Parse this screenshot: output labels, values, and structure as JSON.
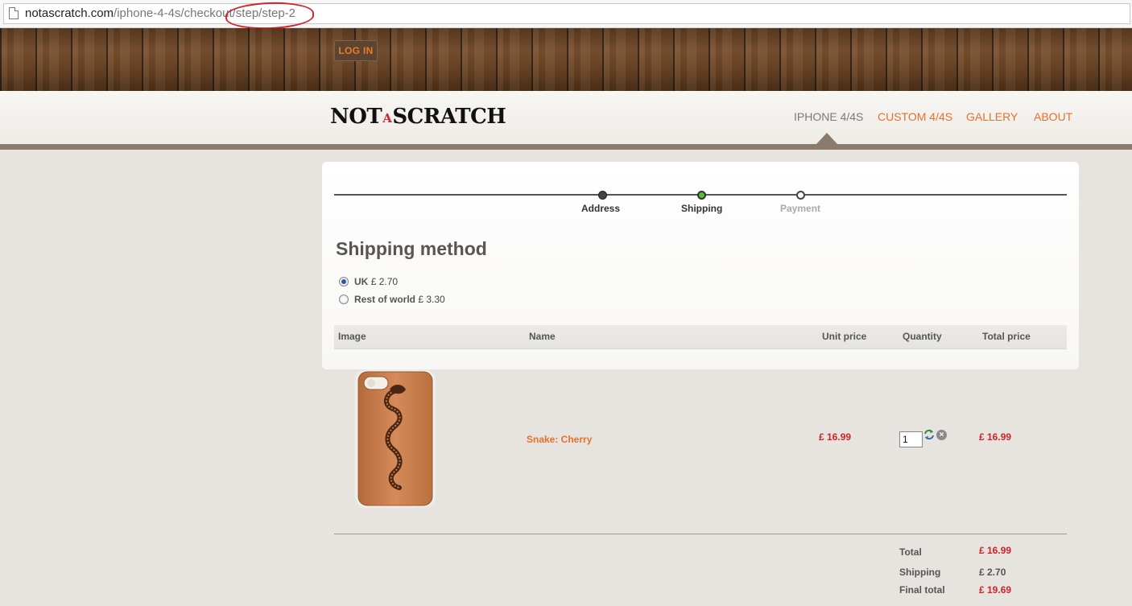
{
  "browser": {
    "url_host": "notascratch.com",
    "url_path_1": "/iphone-4-4s/checkout",
    "url_path_2": "/step/step-2"
  },
  "header": {
    "login_label": "LOG IN"
  },
  "logo": {
    "part1": "NOT",
    "part2": "A",
    "part3": "SCRATCH"
  },
  "nav": {
    "items": [
      {
        "label": "IPHONE 4/4S",
        "active": true
      },
      {
        "label": "CUSTOM 4/4S",
        "active": false
      },
      {
        "label": "GALLERY",
        "active": false
      },
      {
        "label": "ABOUT",
        "active": false
      }
    ]
  },
  "steps": [
    {
      "label": "Address",
      "state": "done"
    },
    {
      "label": "Shipping",
      "state": "current"
    },
    {
      "label": "Payment",
      "state": "todo"
    }
  ],
  "shipping": {
    "title": "Shipping method",
    "options": [
      {
        "name": "UK",
        "price": "£ 2.70",
        "selected": true
      },
      {
        "name": "Rest of world",
        "price": "£ 3.30",
        "selected": false
      }
    ]
  },
  "cart": {
    "headers": {
      "image": "Image",
      "name": "Name",
      "unit_price": "Unit price",
      "quantity": "Quantity",
      "total_price": "Total price"
    },
    "items": [
      {
        "name": "Snake: Cherry",
        "unit_price": "£ 16.99",
        "quantity": "1",
        "total_price": "£ 16.99"
      }
    ]
  },
  "summary": {
    "total_label": "Total",
    "total_value": "£ 16.99",
    "shipping_label": "Shipping",
    "shipping_value": "£ 2.70",
    "final_label": "Final total",
    "final_value": "£ 19.69"
  },
  "colors": {
    "accent": "#e8702a",
    "price_red": "#d0232a",
    "step_current": "#4fc23a",
    "annotation": "#d0232a"
  }
}
